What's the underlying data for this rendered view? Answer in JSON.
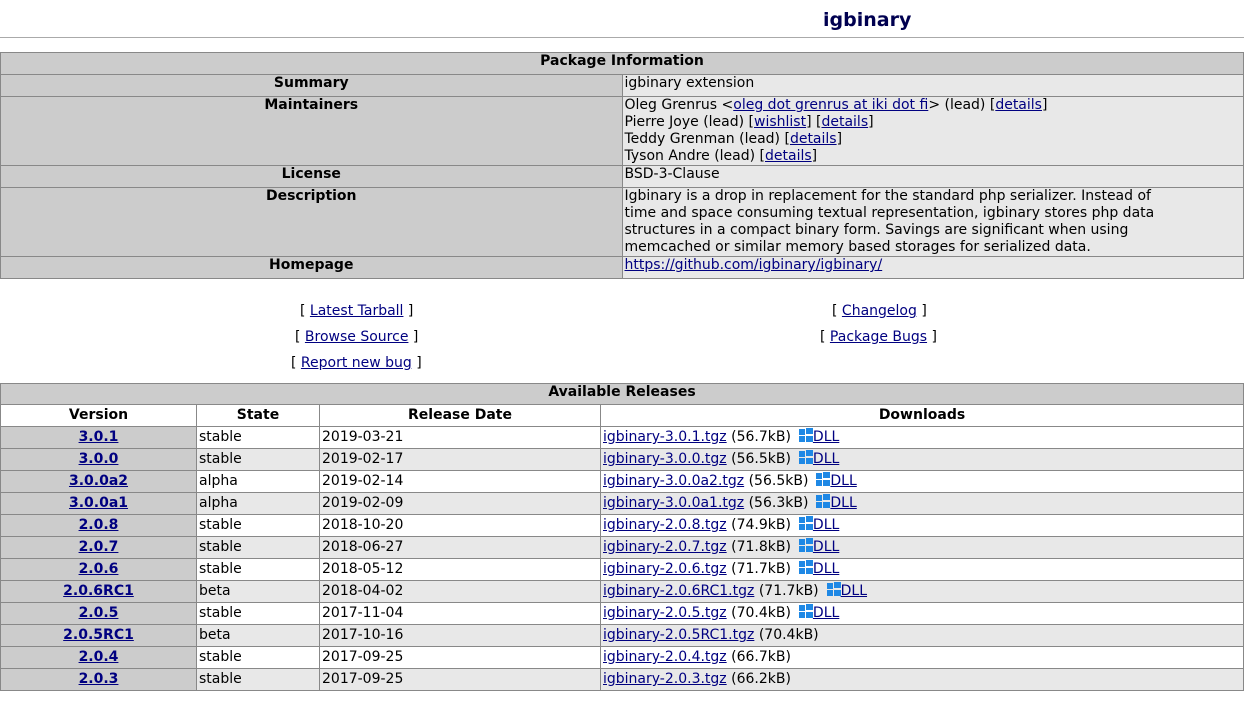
{
  "page_title": "igbinary",
  "package_info": {
    "heading": "Package Information",
    "summary_label": "Summary",
    "summary": "igbinary extension",
    "maintainers_label": "Maintainers",
    "maintainers": [
      {
        "pre": "Oleg Grenrus <",
        "email": "oleg dot grenrus at iki dot fi",
        "mid": "> (lead) [",
        "details": "details",
        "post": "]"
      },
      {
        "pre": "Pierre Joye (lead) [",
        "wishlist": "wishlist",
        "mid": "] [",
        "details": "details",
        "post": "]"
      },
      {
        "pre": "Teddy Grenman (lead) [",
        "details": "details",
        "post": "]"
      },
      {
        "pre": "Tyson Andre (lead) [",
        "details": "details",
        "post": "]"
      }
    ],
    "license_label": "License",
    "license": "BSD-3-Clause",
    "description_label": "Description",
    "description_lines": [
      "Igbinary is a drop in replacement for the standard php serializer. Instead of",
      "time and space consuming textual representation, igbinary stores php data",
      "structures in a compact binary form. Savings are significant when using",
      "memcached or similar memory based storages for serialized data."
    ],
    "homepage_label": "Homepage",
    "homepage": "https://github.com/igbinary/igbinary/"
  },
  "links": {
    "latest_tarball": "Latest Tarball",
    "browse_source": "Browse Source",
    "report_bug": "Report new bug",
    "changelog": "Changelog",
    "package_bugs": "Package Bugs",
    "open_bracket": "[",
    "close_bracket": "]"
  },
  "releases": {
    "heading": "Available Releases",
    "columns": [
      "Version",
      "State",
      "Release Date",
      "Downloads"
    ],
    "dll_label": "DLL",
    "rows": [
      {
        "version": "3.0.1",
        "state": "stable",
        "date": "2019-03-21",
        "file": "igbinary-3.0.1.tgz",
        "size": "(56.7kB)",
        "dll": true
      },
      {
        "version": "3.0.0",
        "state": "stable",
        "date": "2019-02-17",
        "file": "igbinary-3.0.0.tgz",
        "size": "(56.5kB)",
        "dll": true
      },
      {
        "version": "3.0.0a2",
        "state": "alpha",
        "date": "2019-02-14",
        "file": "igbinary-3.0.0a2.tgz",
        "size": "(56.5kB)",
        "dll": true
      },
      {
        "version": "3.0.0a1",
        "state": "alpha",
        "date": "2019-02-09",
        "file": "igbinary-3.0.0a1.tgz",
        "size": "(56.3kB)",
        "dll": true
      },
      {
        "version": "2.0.8",
        "state": "stable",
        "date": "2018-10-20",
        "file": "igbinary-2.0.8.tgz",
        "size": "(74.9kB)",
        "dll": true
      },
      {
        "version": "2.0.7",
        "state": "stable",
        "date": "2018-06-27",
        "file": "igbinary-2.0.7.tgz",
        "size": "(71.8kB)",
        "dll": true
      },
      {
        "version": "2.0.6",
        "state": "stable",
        "date": "2018-05-12",
        "file": "igbinary-2.0.6.tgz",
        "size": "(71.7kB)",
        "dll": true
      },
      {
        "version": "2.0.6RC1",
        "state": "beta",
        "date": "2018-04-02",
        "file": "igbinary-2.0.6RC1.tgz",
        "size": "(71.7kB)",
        "dll": true
      },
      {
        "version": "2.0.5",
        "state": "stable",
        "date": "2017-11-04",
        "file": "igbinary-2.0.5.tgz",
        "size": "(70.4kB)",
        "dll": true
      },
      {
        "version": "2.0.5RC1",
        "state": "beta",
        "date": "2017-10-16",
        "file": "igbinary-2.0.5RC1.tgz",
        "size": "(70.4kB)",
        "dll": false
      },
      {
        "version": "2.0.4",
        "state": "stable",
        "date": "2017-09-25",
        "file": "igbinary-2.0.4.tgz",
        "size": "(66.7kB)",
        "dll": false
      },
      {
        "version": "2.0.3",
        "state": "stable",
        "date": "2017-09-25",
        "file": "igbinary-2.0.3.tgz",
        "size": "(66.2kB)",
        "dll": false
      }
    ]
  }
}
